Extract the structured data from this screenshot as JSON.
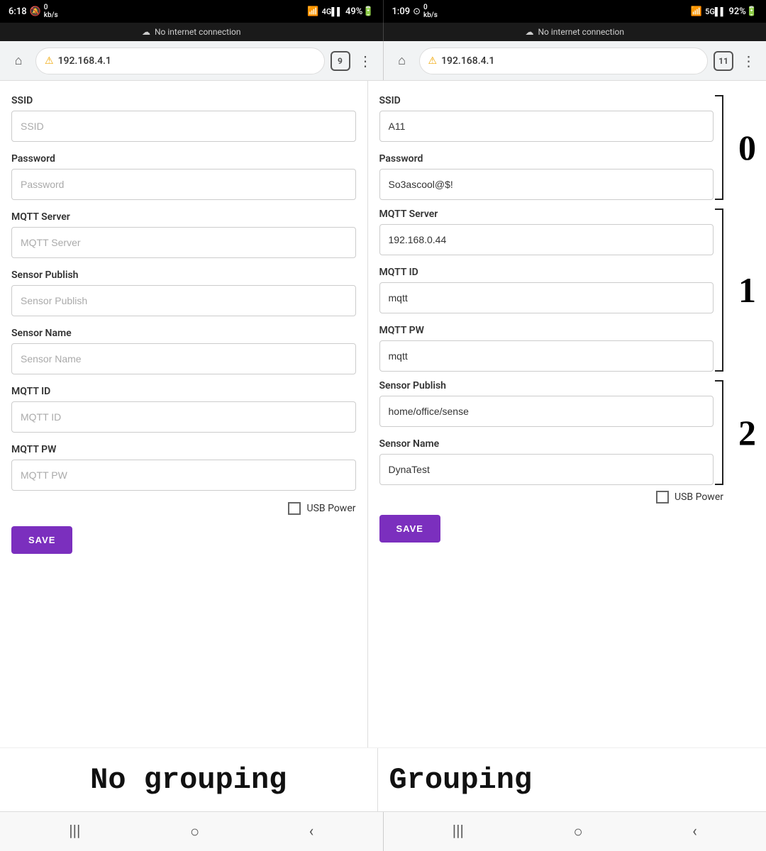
{
  "left_status": {
    "time": "6:18",
    "icons_left": "🔕 0 kb/s",
    "signal": "WiFi 4G",
    "battery": "49%"
  },
  "right_status": {
    "time": "1:09",
    "icons_left": "⊕ 0 kb/s",
    "signal": "WiFi 5G",
    "battery": "92%"
  },
  "no_internet": "No internet connection",
  "left_url": "192.168.4.1",
  "right_url": "192.168.4.1",
  "left_tabs": "9",
  "right_tabs": "11",
  "left_form": {
    "ssid_label": "SSID",
    "ssid_placeholder": "SSID",
    "ssid_value": "",
    "password_label": "Password",
    "password_placeholder": "Password",
    "password_value": "",
    "mqtt_server_label": "MQTT Server",
    "mqtt_server_placeholder": "MQTT Server",
    "mqtt_server_value": "",
    "sensor_publish_label": "Sensor Publish",
    "sensor_publish_placeholder": "Sensor Publish",
    "sensor_publish_value": "",
    "sensor_name_label": "Sensor Name",
    "sensor_name_placeholder": "Sensor Name",
    "sensor_name_value": "",
    "mqtt_id_label": "MQTT ID",
    "mqtt_id_placeholder": "MQTT ID",
    "mqtt_id_value": "",
    "mqtt_pw_label": "MQTT PW",
    "mqtt_pw_placeholder": "MQTT PW",
    "mqtt_pw_value": "",
    "usb_power_label": "USB Power",
    "save_label": "SAVE"
  },
  "right_form": {
    "ssid_label": "SSID",
    "ssid_value": "A11",
    "password_label": "Password",
    "password_value": "So3ascool@$!",
    "mqtt_server_label": "MQTT Server",
    "mqtt_server_value": "192.168.0.44",
    "mqtt_id_label": "MQTT ID",
    "mqtt_id_value": "mqtt",
    "mqtt_pw_label": "MQTT PW",
    "mqtt_pw_value": "mqtt",
    "sensor_publish_label": "Sensor Publish",
    "sensor_publish_value": "home/office/sense",
    "sensor_name_label": "Sensor Name",
    "sensor_name_value": "DynaTest",
    "usb_power_label": "USB Power",
    "save_label": "SAVE",
    "group0_num": "0",
    "group1_num": "1",
    "group2_num": "2"
  },
  "bottom_left_label": "No grouping",
  "bottom_right_label": "Grouping",
  "nav": {
    "lines_icon": "|||",
    "circle_icon": "○",
    "back_icon": "‹"
  }
}
